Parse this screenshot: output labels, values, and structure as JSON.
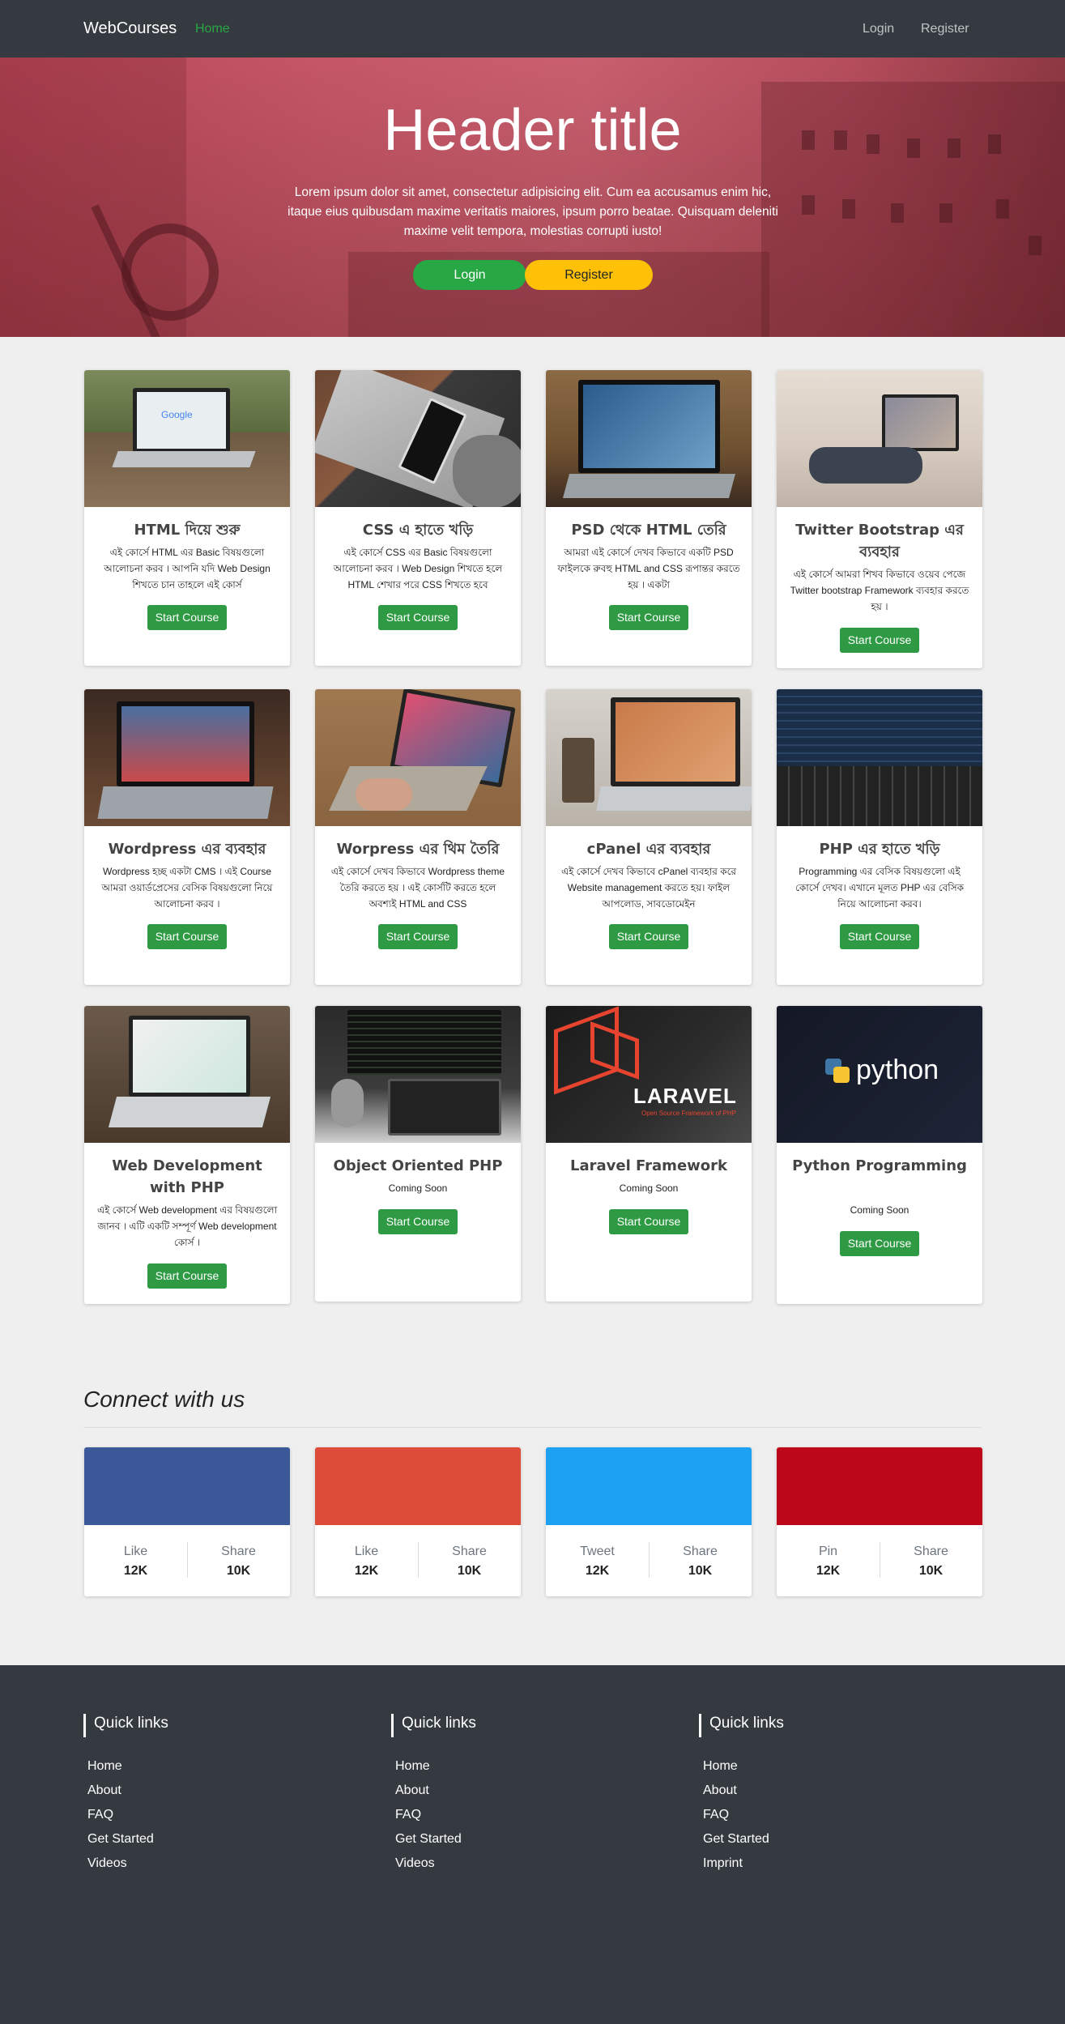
{
  "navbar": {
    "brand": "WebCourses",
    "home": "Home",
    "login": "Login",
    "register": "Register"
  },
  "hero": {
    "title": "Header title",
    "text": "Lorem ipsum dolor sit amet, consectetur adipisicing elit. Cum ea accusamus enim hic, itaque eius quibusdam maxime veritatis maiores, ipsum porro beatae. Quisquam deleniti maxime velit tempora, molestias corrupti iusto!",
    "login": "Login",
    "register": "Register"
  },
  "courses": [
    {
      "title": "HTML দিয়ে শুরু",
      "desc": "এই কোর্সে HTML এর Basic বিষয়গুলো আলোচনা করব । আপনি যদি Web Design শিখতে চান তাহলে এই কোর্স",
      "button": "Start Course"
    },
    {
      "title": "CSS এ হাতে খড়ি",
      "desc": "এই কোর্সে CSS এর Basic বিষয়গুলো আলোচনা করব । Web Design শিখতে হলে HTML শেখার পরে CSS শিখতে হবে",
      "button": "Start Course"
    },
    {
      "title": "PSD থেকে HTML তেরি",
      "desc": "আমরা এই কোর্সে দেখব কিভাবে একটি PSD ফাইলকে রুবহু HTML and CSS রূপান্তর করতে হয় । একটা",
      "button": "Start Course"
    },
    {
      "title": "Twitter Bootstrap এর ব্যবহার",
      "desc": "এই কোর্সে আমরা শিখব কিভাবে ওয়েব পেজে Twitter bootstrap Framework ব্যবহার করতে হয় ।",
      "button": "Start Course"
    },
    {
      "title": "Wordpress এর ব্যবহার",
      "desc": "Wordpress হচ্ছ একটা CMS । এই Course আমরা ওয়ার্ডপ্রেসের বেসিক বিষয়গুলো নিয়ে আলোচনা করব ।",
      "button": "Start Course"
    },
    {
      "title": "Worpress এর থিম তৈরি",
      "desc": "এই কোর্সে দেখব কিভাবে Wordpress theme তৈরি করতে হয় । এই কোর্সটি করতে হলে অবশ্যই HTML and CSS",
      "button": "Start Course"
    },
    {
      "title": "cPanel এর ব্যবহার",
      "desc": "এই কোর্সে দেখব কিভাবে cPanel ব্যবহার করে Website management করতে হয়। ফাইল আপলোড, সাবডোমেইন",
      "button": "Start Course"
    },
    {
      "title": "PHP এর হাতে খড়ি",
      "desc": "Programming এর বেসিক বিষয়গুলো এই কোর্সে দেখব। এখানে মূলত PHP এর বেসিক নিয়ে আলোচনা করব।",
      "button": "Start Course"
    },
    {
      "title": "Web Development with PHP",
      "desc": "এই কোর্সে Web development এর বিষয়গুলো জানব । এটি একটি সম্পূর্ণ Web development কোর্স ।",
      "button": "Start Course"
    },
    {
      "title": "Object Oriented PHP",
      "desc": "Coming Soon",
      "button": "Start Course"
    },
    {
      "title": "Laravel Framework",
      "desc": "Coming Soon",
      "button": "Start Course"
    },
    {
      "title": "Python Programming",
      "desc": "Coming Soon",
      "button": "Start Course"
    }
  ],
  "thumb_text": {
    "laravel": "LARAVEL",
    "laravel_sub": "Open Source Framework of PHP",
    "python": "python",
    "google": "Google"
  },
  "connect": {
    "title": "Connect with us",
    "cards": [
      {
        "color": "#3b5998",
        "left_label": "Like",
        "left_value": "12K",
        "right_label": "Share",
        "right_value": "10K"
      },
      {
        "color": "#dd4b39",
        "left_label": "Like",
        "left_value": "12K",
        "right_label": "Share",
        "right_value": "10K"
      },
      {
        "color": "#1da1f2",
        "left_label": "Tweet",
        "left_value": "12K",
        "right_label": "Share",
        "right_value": "10K"
      },
      {
        "color": "#bd081c",
        "left_label": "Pin",
        "left_value": "12K",
        "right_label": "Share",
        "right_value": "10K"
      }
    ]
  },
  "footer": {
    "columns": [
      {
        "title": "Quick links",
        "links": [
          "Home",
          "About",
          "FAQ",
          "Get Started",
          "Videos"
        ]
      },
      {
        "title": "Quick links",
        "links": [
          "Home",
          "About",
          "FAQ",
          "Get Started",
          "Videos"
        ]
      },
      {
        "title": "Quick links",
        "links": [
          "Home",
          "About",
          "FAQ",
          "Get Started",
          "Imprint"
        ]
      }
    ]
  }
}
